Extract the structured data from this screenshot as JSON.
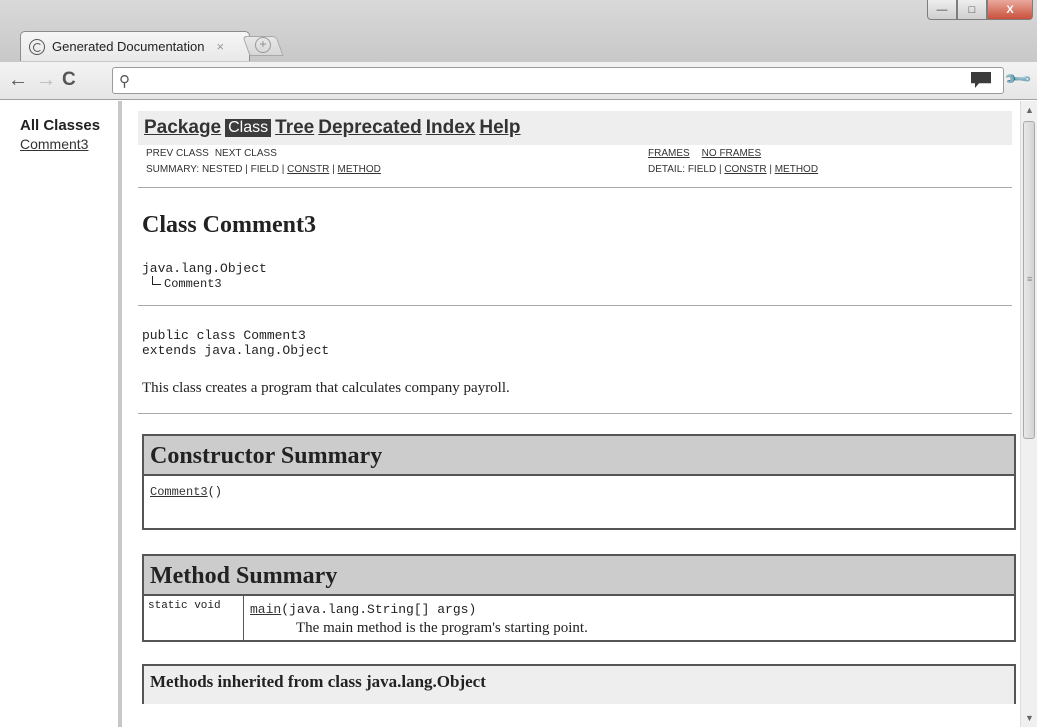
{
  "window": {
    "tab_title": "Generated Documentation",
    "tab_close": "×",
    "newtab_glyph": "+",
    "min_glyph": "—",
    "max_glyph": "□",
    "close_glyph": "X"
  },
  "toolbar": {
    "back_glyph": "←",
    "forward_glyph": "→",
    "reload_glyph": "C",
    "search_glyph": "⚲",
    "address_value": "",
    "wrench_glyph": "🔧"
  },
  "left_frame": {
    "heading": "All Classes",
    "classes": [
      "Comment3"
    ]
  },
  "nav": {
    "items": [
      "Package",
      "Class",
      "Tree",
      "Deprecated",
      "Index",
      "Help"
    ],
    "current": "Class"
  },
  "subnav": {
    "prev_class": "PREV CLASS",
    "next_class": "NEXT CLASS",
    "frames": "FRAMES",
    "no_frames": "NO FRAMES",
    "summary_prefix": "SUMMARY: NESTED | FIELD | ",
    "summary_constr": "CONSTR",
    "summary_sep": " | ",
    "summary_method": "METHOD",
    "detail_prefix": "DETAIL: FIELD | ",
    "detail_constr": "CONSTR",
    "detail_sep": " | ",
    "detail_method": "METHOD"
  },
  "class_doc": {
    "title": "Class Comment3",
    "hierarchy_parent": "java.lang.Object",
    "hierarchy_child": "Comment3",
    "decl_line1": "public class Comment3",
    "decl_line2": "extends java.lang.Object",
    "description": "This class creates a program that calculates company payroll."
  },
  "constructor_summary": {
    "heading": "Constructor Summary",
    "name": "Comment3",
    "params": "()"
  },
  "method_summary": {
    "heading": "Method Summary",
    "modifier": "static void",
    "name": "main",
    "params": "(java.lang.String[] args)",
    "description": "The main method is the program's starting point."
  },
  "inherited": {
    "heading": "Methods inherited from class java.lang.Object"
  },
  "colors": {
    "nav_current_bg": "#3c3c3c",
    "summary_header_bg": "#cccccc",
    "navbar_bg": "#eeeeee"
  }
}
